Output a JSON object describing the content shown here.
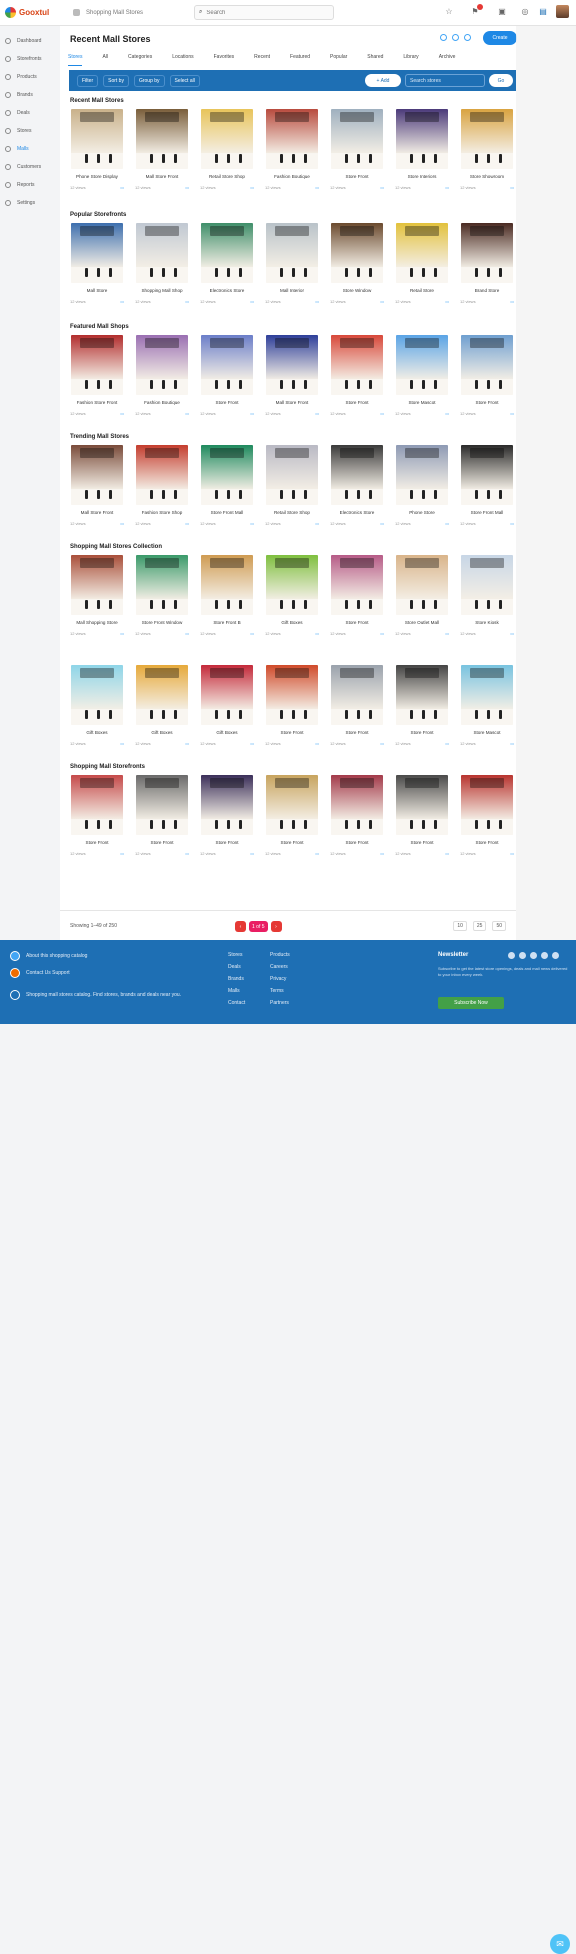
{
  "app": {
    "logo_text": "Gooxtul",
    "breadcrumb": "Shopping Mall Stores"
  },
  "search": {
    "placeholder": "Search"
  },
  "sidebar": {
    "items": [
      {
        "label": "Dashboard",
        "icon": "home-icon"
      },
      {
        "label": "Storefronts",
        "icon": "store-icon"
      },
      {
        "label": "Products",
        "icon": "tag-icon"
      },
      {
        "label": "Brands",
        "icon": "star-icon"
      },
      {
        "label": "Deals",
        "icon": "percent-icon"
      },
      {
        "label": "Stores",
        "icon": "cart-icon"
      },
      {
        "label": "Malls",
        "icon": "building-icon"
      },
      {
        "label": "Customers",
        "icon": "users-icon"
      },
      {
        "label": "Reports",
        "icon": "chart-icon"
      },
      {
        "label": "Settings",
        "icon": "gear-icon"
      }
    ],
    "active": 6
  },
  "header": {
    "title": "Recent Mall Stores",
    "button": "Create"
  },
  "tabs": [
    "Stores",
    "All",
    "Categories",
    "Locations",
    "Favorites",
    "Recent",
    "Featured",
    "Popular",
    "Shared",
    "Library",
    "Archive"
  ],
  "toolbar": {
    "buttons": [
      "Filter",
      "Sort by",
      "Group by",
      "Select all"
    ],
    "pill": "+ Add",
    "search_placeholder": "Search stores",
    "go": "Go"
  },
  "sections": [
    {
      "title": "Recent Mall Stores",
      "labels": [
        "Phone Store Display",
        "Mall Store Front",
        "Retail Store Shop",
        "Fashion Boutique",
        "Store Front",
        "Store Interiors",
        "Store Showroom"
      ]
    },
    {
      "title": "Popular Storefronts",
      "labels": [
        "Mall Store",
        "Shopping Mall Shop",
        "Electronics Store",
        "Mall Interior",
        "Store Window",
        "Retail Store",
        "Brand Store"
      ]
    },
    {
      "title": "Featured Mall Shops",
      "labels": [
        "Fashion Store Front",
        "Fashion Boutique",
        "Store Front",
        "Mall Store Front",
        "Store Front",
        "Store Mascot",
        "Store Front"
      ]
    },
    {
      "title": "Trending Mall Stores",
      "labels": [
        "Mall Store Front",
        "Fashion Store Shop",
        "Store Front Mall",
        "Retail Store Shop",
        "Electronics Store",
        "Phone Store",
        "Store Front Mall"
      ]
    },
    {
      "title": "Shopping Mall Stores Collection",
      "labels": [
        "Mall Shopping Store",
        "Store Front Window",
        "Store Front B",
        "Gift Boxes",
        "Store Front",
        "Store Outlet Mall",
        "Store Kiosk"
      ]
    },
    {
      "title": "",
      "labels": [
        "Gift Boxes",
        "Gift Boxes",
        "Gift Boxes",
        "Store Front",
        "Store Front",
        "Store Front",
        "Store Mascot"
      ]
    },
    {
      "title": "Shopping Mall Storefronts",
      "labels": [
        "Store Front",
        "Store Front",
        "Store Front",
        "Store Front",
        "Store Front",
        "Store Front",
        "Store Front"
      ]
    }
  ],
  "thumbs": [
    "#c9b18a",
    "#7a5e3a",
    "#e8c45a",
    "#b84b3e",
    "#9fb0bf",
    "#4b3a7a",
    "#d9a340",
    "#3d6fae",
    "#c0c8d2",
    "#3f8f6a",
    "#b9c2c9",
    "#6b4a2e",
    "#e2c13c",
    "#4a2a22",
    "#b22d2d",
    "#9a6fb2",
    "#6b7ec9",
    "#2e3f9a",
    "#d8483a",
    "#5aa4e6",
    "#6f9fd0",
    "#7a4b3a",
    "#c43d2e",
    "#1e8a5e",
    "#b9b9c4",
    "#3a3a3a",
    "#8e9ab4",
    "#2a2a2a",
    "#a94f3a",
    "#3a9a6a",
    "#cf9b52",
    "#7fbf3f",
    "#b65b87",
    "#d9b48a",
    "#c7d6e6",
    "#8ed5e8",
    "#e6a93a",
    "#c4293a",
    "#d04a2a",
    "#9aa2ac",
    "#444",
    "#78c3e0",
    "#c54a4a",
    "#6a6a6a",
    "#3b2f5a",
    "#c7a45f",
    "#a33a4a",
    "#4a4a4a",
    "#b8342f"
  ],
  "meta": "12 views",
  "footbar": {
    "text": "Showing 1–49 of 250",
    "pages": [
      "‹",
      "1 of 5",
      "›"
    ],
    "right": [
      "10",
      "25",
      "50"
    ]
  },
  "footer": {
    "rows": [
      "About this shopping catalog",
      "Contact Us Support",
      "Shopping mall stores catalog. Find stores, brands and deals near you."
    ],
    "col1": [
      "Stores",
      "Deals",
      "Brands",
      "Malls",
      "Contact"
    ],
    "col2": [
      "Products",
      "Careers",
      "Privacy",
      "Terms",
      "Partners"
    ],
    "newsletter_title": "Newsletter",
    "newsletter_text": "Subscribe to get the latest store openings, deals and mall news delivered to your inbox every week.",
    "button": "Subscribe Now"
  }
}
